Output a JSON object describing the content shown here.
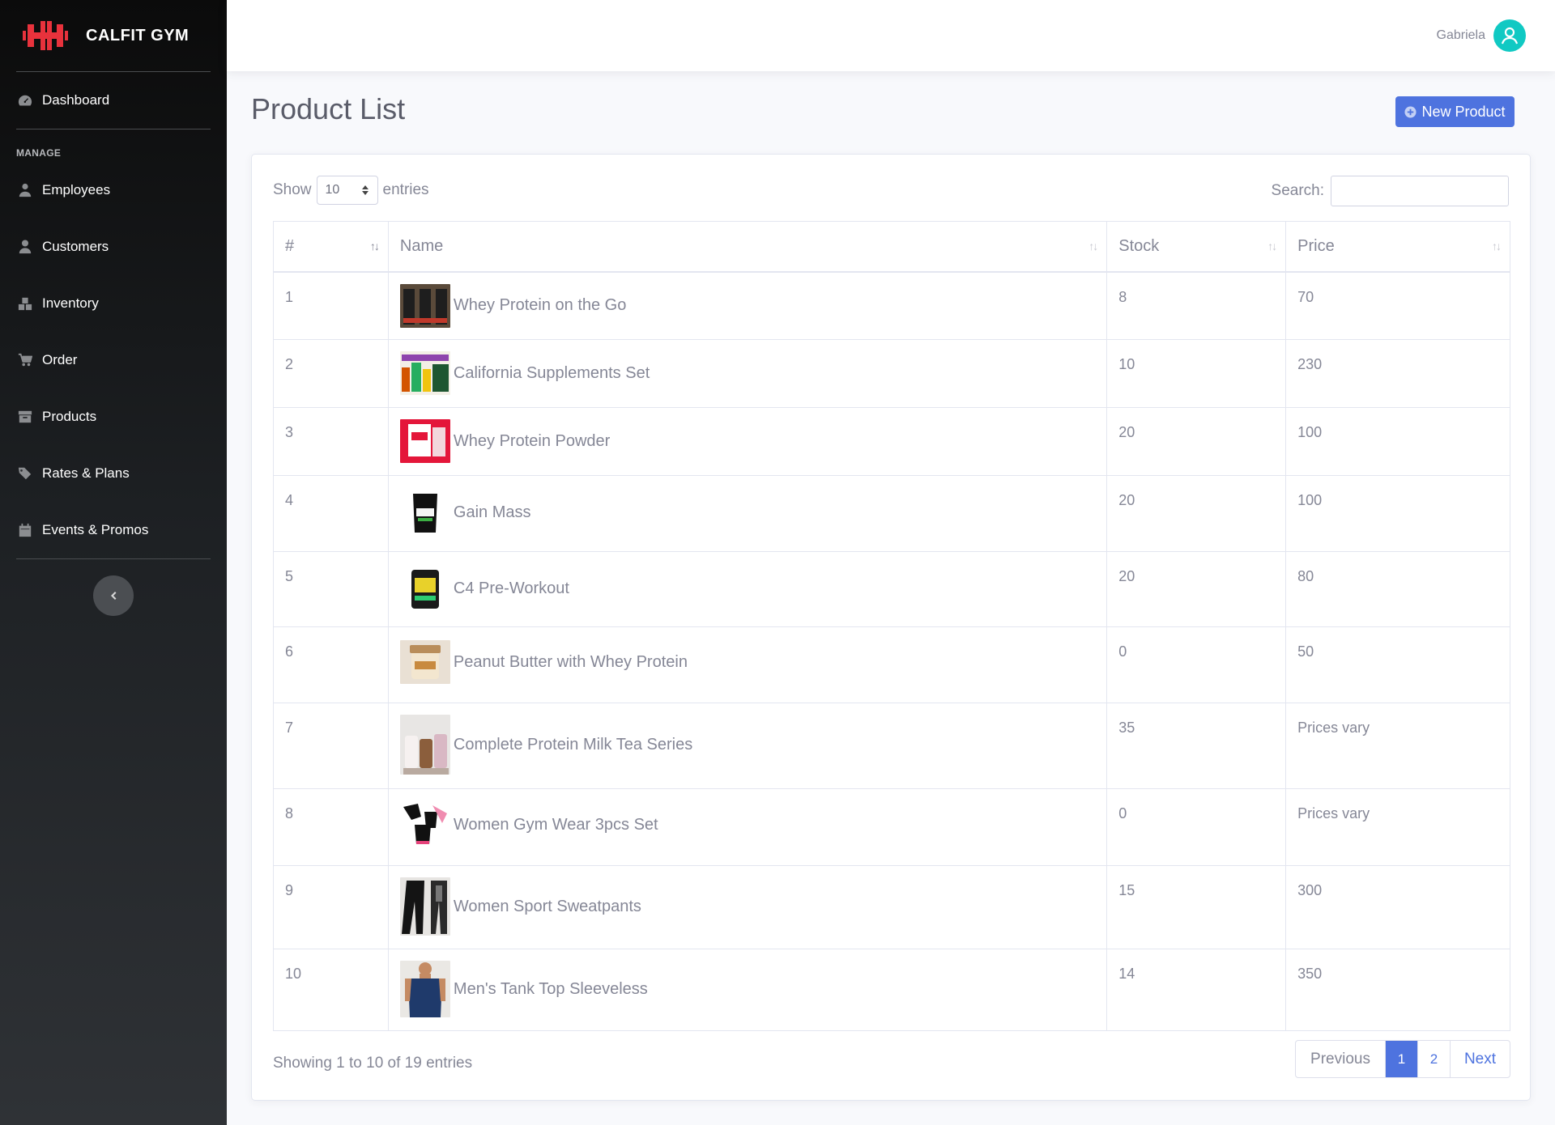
{
  "brand": {
    "name": "CALFIT GYM"
  },
  "sidebar": {
    "dashboard": "Dashboard",
    "heading": "MANAGE",
    "items": [
      {
        "label": "Employees",
        "icon": "user-tie-icon"
      },
      {
        "label": "Customers",
        "icon": "user-icon"
      },
      {
        "label": "Inventory",
        "icon": "boxes-icon"
      },
      {
        "label": "Order",
        "icon": "cart-icon"
      },
      {
        "label": "Products",
        "icon": "archive-icon"
      },
      {
        "label": "Rates & Plans",
        "icon": "tags-icon"
      },
      {
        "label": "Events & Promos",
        "icon": "calendar-icon"
      }
    ]
  },
  "topbar": {
    "user_name": "Gabriela"
  },
  "page": {
    "title": "Product List",
    "new_button": "New Product"
  },
  "table_controls": {
    "show_label": "Show",
    "entries_value": "10",
    "entries_label": "entries",
    "search_label": "Search:",
    "search_value": ""
  },
  "table": {
    "columns": [
      "#",
      "Name",
      "Stock",
      "Price"
    ],
    "rows": [
      {
        "num": "1",
        "name": "Whey Protein on the Go",
        "stock": "8",
        "price": "70"
      },
      {
        "num": "2",
        "name": "California Supplements Set",
        "stock": "10",
        "price": "230"
      },
      {
        "num": "3",
        "name": "Whey Protein Powder",
        "stock": "20",
        "price": "100"
      },
      {
        "num": "4",
        "name": "Gain Mass",
        "stock": "20",
        "price": "100"
      },
      {
        "num": "5",
        "name": "C4 Pre-Workout",
        "stock": "20",
        "price": "80"
      },
      {
        "num": "6",
        "name": "Peanut Butter with Whey Protein",
        "stock": "0",
        "price": "50"
      },
      {
        "num": "7",
        "name": "Complete Protein Milk Tea Series",
        "stock": "35",
        "price": "Prices vary"
      },
      {
        "num": "8",
        "name": "Women Gym Wear 3pcs Set",
        "stock": "0",
        "price": "Prices vary"
      },
      {
        "num": "9",
        "name": "Women Sport Sweatpants",
        "stock": "15",
        "price": "300"
      },
      {
        "num": "10",
        "name": "Men's Tank Top Sleeveless",
        "stock": "14",
        "price": "350"
      }
    ]
  },
  "footer": {
    "info": "Showing 1 to 10 of 19 entries",
    "previous": "Previous",
    "pages": [
      "1",
      "2"
    ],
    "next": "Next"
  },
  "colors": {
    "primary": "#4e73df",
    "brand_red": "#e8323c",
    "avatar": "#10c9c3"
  }
}
